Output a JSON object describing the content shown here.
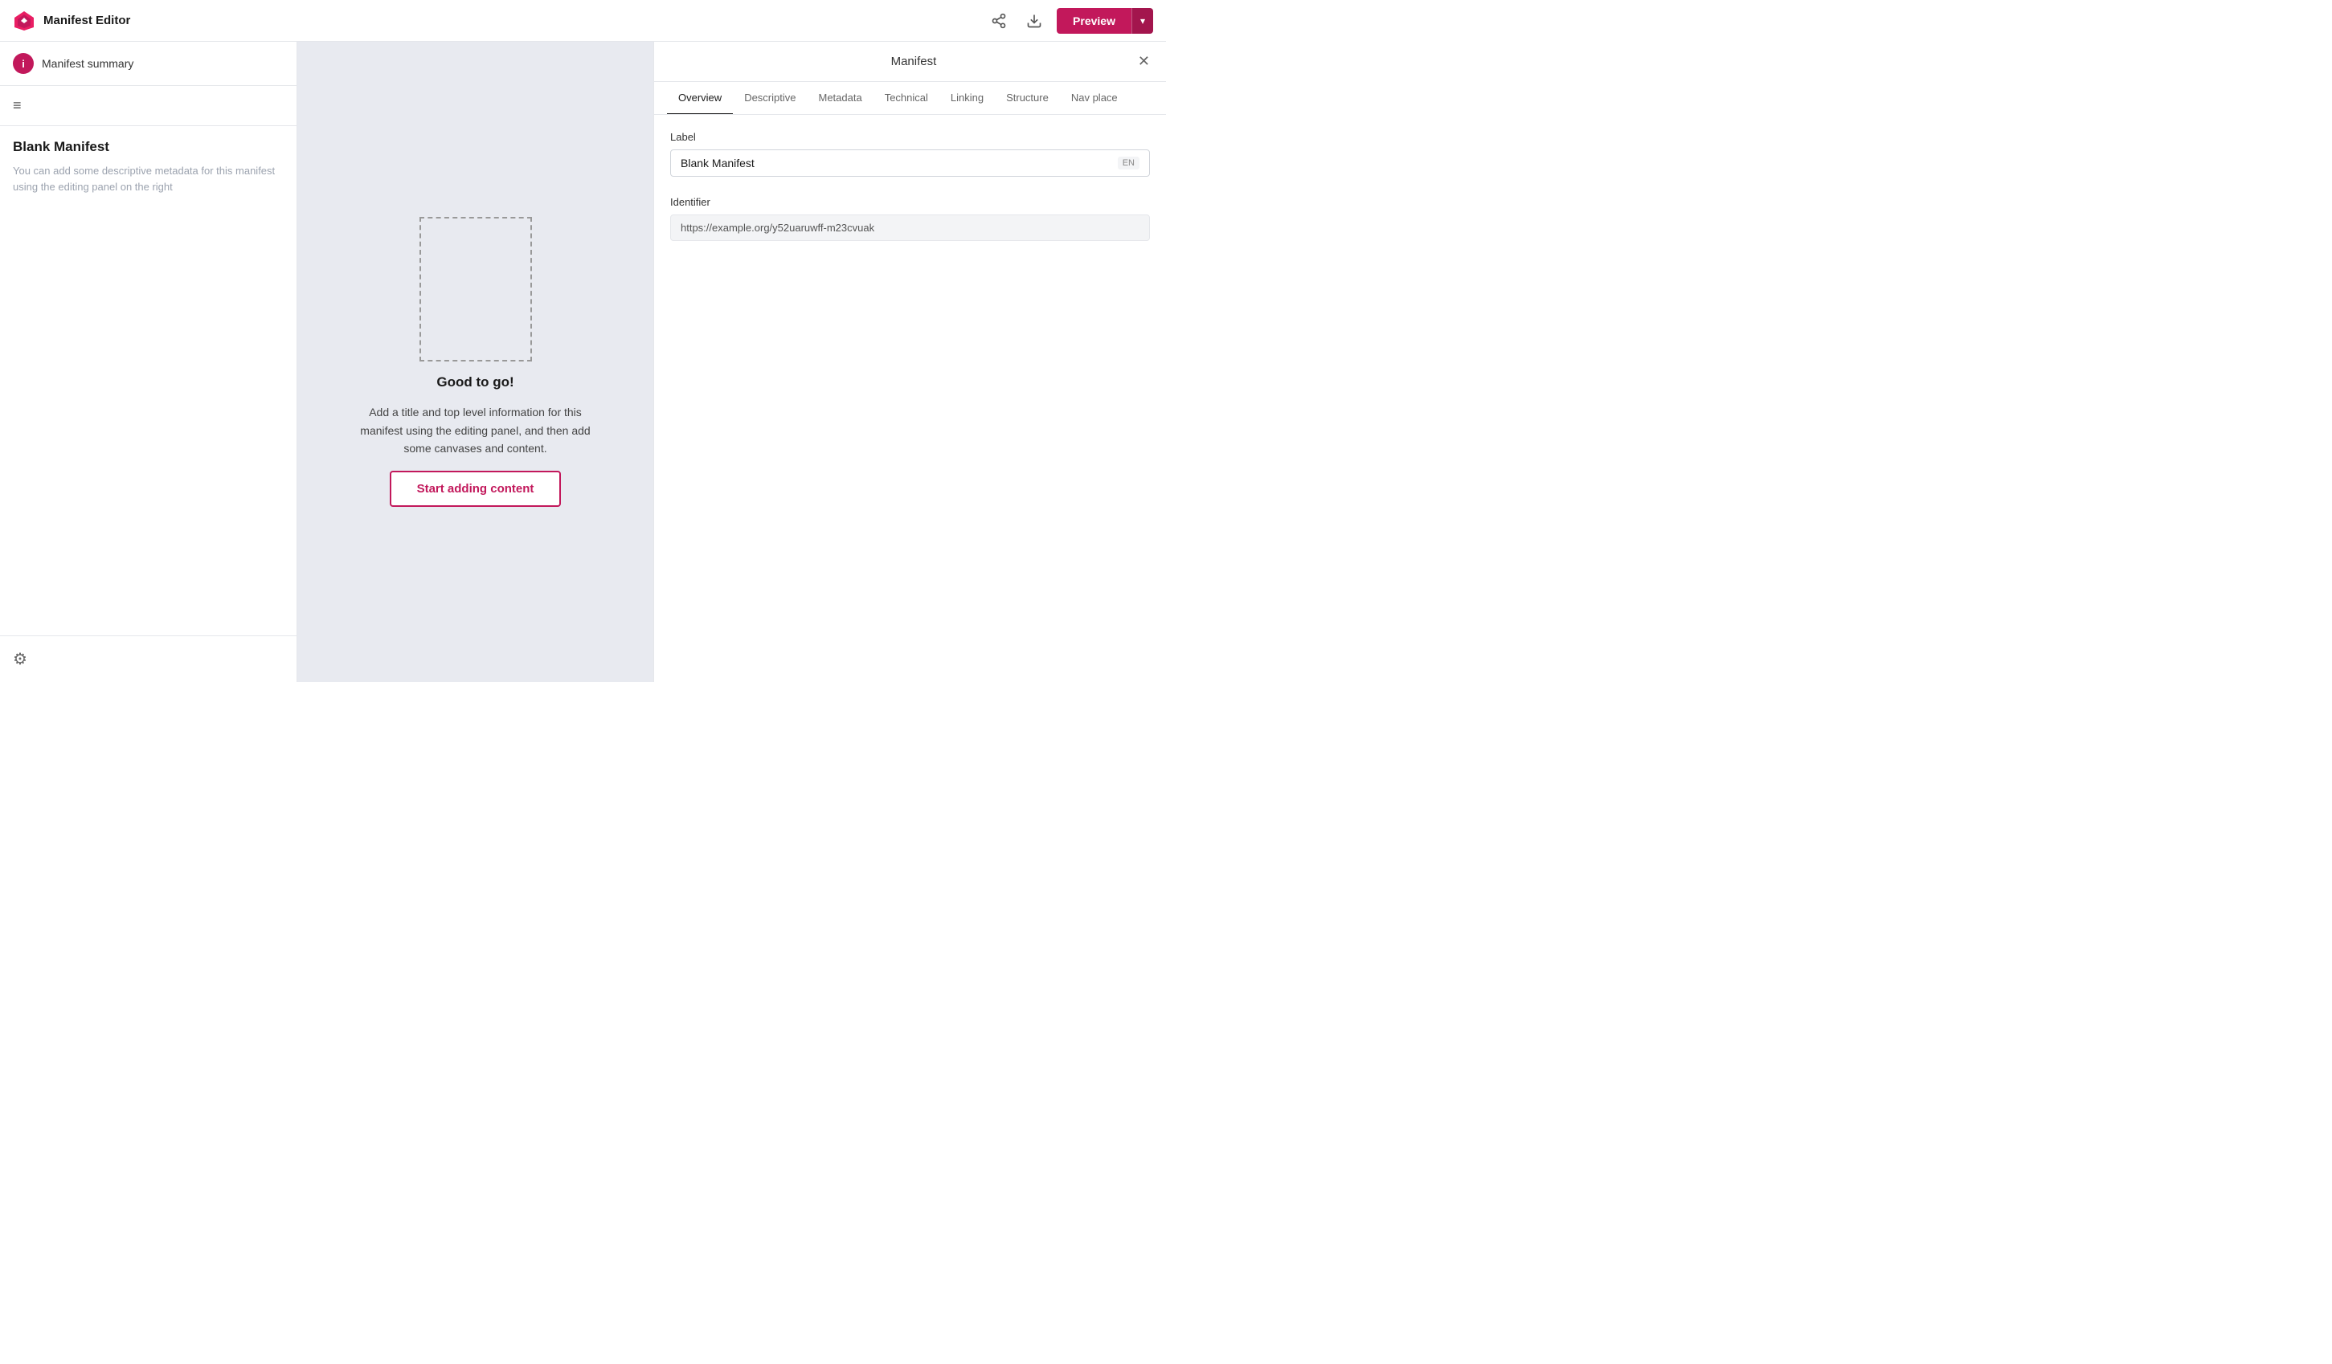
{
  "header": {
    "app_title": "Manifest Editor",
    "preview_label": "Preview",
    "dropdown_icon": "▾"
  },
  "sidebar": {
    "summary_label": "Manifest summary",
    "manifest_name": "Blank Manifest",
    "manifest_desc": "You can add some descriptive metadata for this manifest using the editing panel on the right"
  },
  "canvas": {
    "good_to_go": "Good to go!",
    "description": "Add a title and top level information for this manifest using the editing panel, and then add some canvases and content.",
    "start_adding_label": "Start adding content"
  },
  "panel": {
    "title": "Manifest",
    "tabs": [
      {
        "id": "overview",
        "label": "Overview",
        "active": true
      },
      {
        "id": "descriptive",
        "label": "Descriptive",
        "active": false
      },
      {
        "id": "metadata",
        "label": "Metadata",
        "active": false
      },
      {
        "id": "technical",
        "label": "Technical",
        "active": false
      },
      {
        "id": "linking",
        "label": "Linking",
        "active": false
      },
      {
        "id": "structure",
        "label": "Structure",
        "active": false
      },
      {
        "id": "nav_place",
        "label": "Nav place",
        "active": false
      }
    ],
    "label_field": {
      "label": "Label",
      "value": "Blank Manifest",
      "lang": "EN"
    },
    "identifier_field": {
      "label": "Identifier",
      "value": "https://example.org/y52uaruwff-m23cvuak"
    }
  },
  "icons": {
    "share": "↑",
    "download": "⬇",
    "close": "✕",
    "gear": "⚙",
    "info": "i",
    "lines": "≡"
  }
}
